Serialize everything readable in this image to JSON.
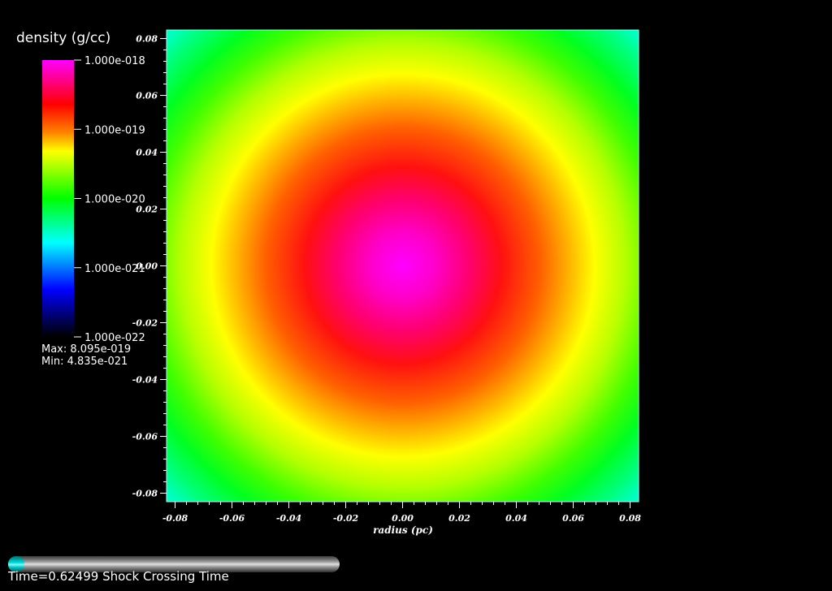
{
  "legend": {
    "title": "density (g/cc)",
    "ticks": [
      "1.000e-018",
      "1.000e-019",
      "1.000e-020",
      "1.000e-021",
      "1.000e-022"
    ],
    "max_label": "Max:  8.095e-019",
    "min_label": "Min:  4.835e-021",
    "colors": [
      "#ff00ff",
      "#ff0000",
      "#ffff00",
      "#00ff00",
      "#00ffff",
      "#0000ff",
      "#000000"
    ]
  },
  "chart_data": {
    "type": "heatmap",
    "title": "",
    "xlabel": "radius (pc)",
    "ylabel": "",
    "xlim": [
      -0.083,
      0.083
    ],
    "ylim": [
      -0.083,
      0.083
    ],
    "x_ticks": [
      "-0.08",
      "-0.06",
      "-0.04",
      "-0.02",
      "0.00",
      "0.02",
      "0.04",
      "0.06",
      "0.08"
    ],
    "y_ticks": [
      "-0.08",
      "-0.06",
      "-0.04",
      "-0.02",
      "0.00",
      "0.02",
      "0.04",
      "0.06",
      "0.08"
    ],
    "x_tick_values": [
      -0.08,
      -0.06,
      -0.04,
      -0.02,
      0.0,
      0.02,
      0.04,
      0.06,
      0.08
    ],
    "y_tick_values": [
      -0.08,
      -0.06,
      -0.04,
      -0.02,
      0.0,
      0.02,
      0.04,
      0.06,
      0.08
    ],
    "colorscale": "log",
    "value_range": [
      1e-22,
      1e-18
    ],
    "field_max": 8.095e-19,
    "field_min": 4.835e-21,
    "center": [
      0.0,
      0.0
    ]
  },
  "time": {
    "label": "Time=0.62499 Shock Crossing Time",
    "progress": 0.05
  }
}
